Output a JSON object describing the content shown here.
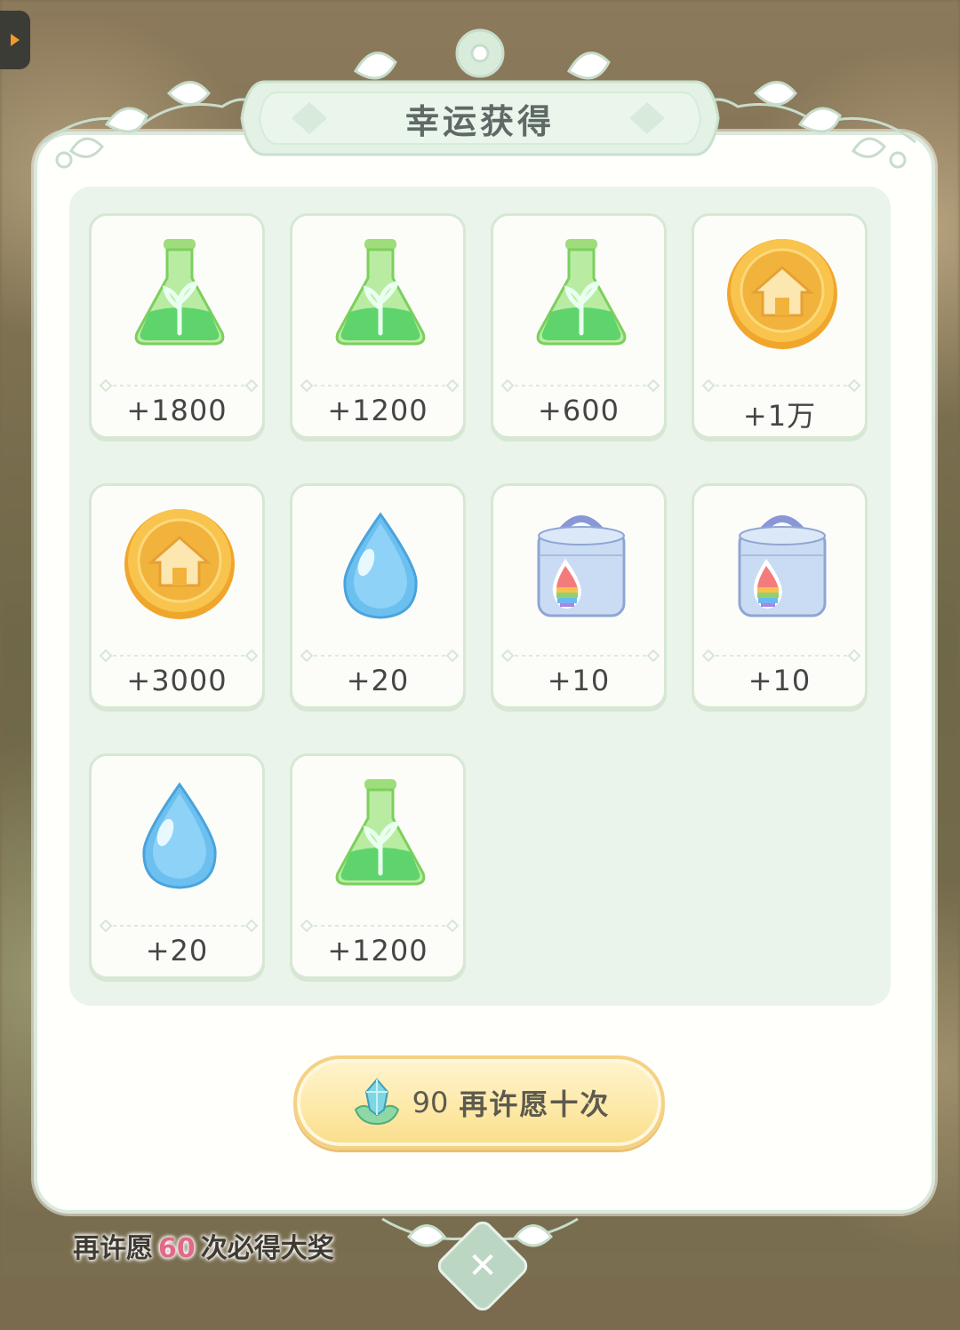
{
  "dialog": {
    "title": "幸运获得"
  },
  "rewards": [
    {
      "icon": "green-potion-icon",
      "amount": "+1800"
    },
    {
      "icon": "green-potion-icon",
      "amount": "+1200"
    },
    {
      "icon": "green-potion-icon",
      "amount": "+600"
    },
    {
      "icon": "gold-coin-icon",
      "amount": "+1万"
    },
    {
      "icon": "gold-coin-icon",
      "amount": "+3000"
    },
    {
      "icon": "water-drop-icon",
      "amount": "+20"
    },
    {
      "icon": "rainbow-dye-box-icon",
      "amount": "+10"
    },
    {
      "icon": "rainbow-dye-box-icon",
      "amount": "+10"
    },
    {
      "icon": "water-drop-icon",
      "amount": "+20"
    },
    {
      "icon": "green-potion-icon",
      "amount": "+1200"
    }
  ],
  "wish_button": {
    "cost": "90",
    "label": "再许愿十次",
    "currency_icon": "crystal-lotus-icon"
  },
  "hint": {
    "prefix": "再许愿",
    "count": "60",
    "suffix": "次必得大奖"
  },
  "close": {
    "icon": "close-icon"
  },
  "colors": {
    "panel_border": "#dbe9dc",
    "grid_bg": "#eaf4ea",
    "button_gold": "#f9dd8a",
    "hint_accent": "#e06a88"
  }
}
